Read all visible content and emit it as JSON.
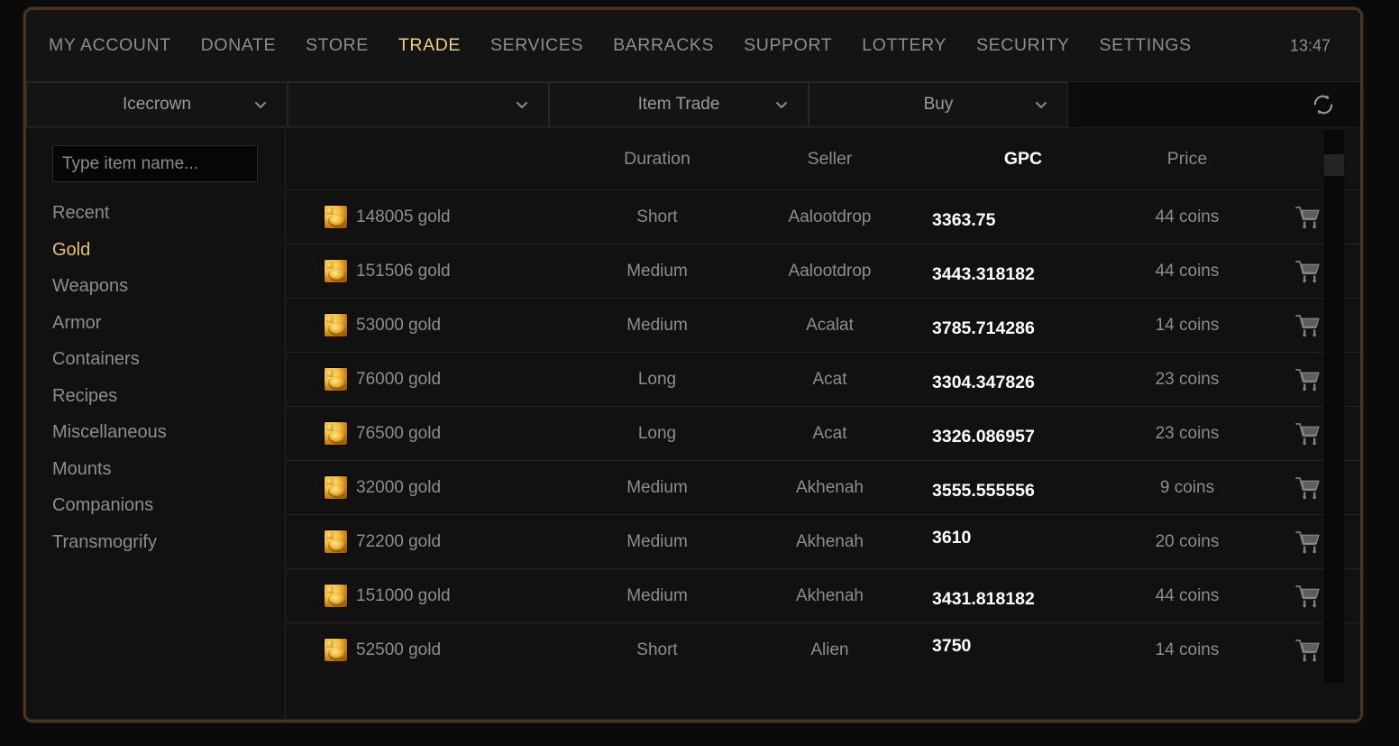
{
  "nav": {
    "items": [
      {
        "label": "MY ACCOUNT",
        "active": false
      },
      {
        "label": "DONATE",
        "active": false
      },
      {
        "label": "STORE",
        "active": false
      },
      {
        "label": "TRADE",
        "active": true
      },
      {
        "label": "SERVICES",
        "active": false
      },
      {
        "label": "BARRACKS",
        "active": false
      },
      {
        "label": "SUPPORT",
        "active": false
      },
      {
        "label": "LOTTERY",
        "active": false
      },
      {
        "label": "SECURITY",
        "active": false
      },
      {
        "label": "SETTINGS",
        "active": false
      }
    ],
    "clock": "13:47"
  },
  "filters": {
    "realm": "Icecrown",
    "character": "",
    "trade_type": "Item Trade",
    "action": "Buy",
    "refresh_icon": "refresh-icon"
  },
  "sidebar": {
    "search_placeholder": "Type item name...",
    "search_value": "",
    "categories": [
      {
        "label": "Recent",
        "active": false
      },
      {
        "label": "Gold",
        "active": true
      },
      {
        "label": "Weapons",
        "active": false
      },
      {
        "label": "Armor",
        "active": false
      },
      {
        "label": "Containers",
        "active": false
      },
      {
        "label": "Recipes",
        "active": false
      },
      {
        "label": "Miscellaneous",
        "active": false
      },
      {
        "label": "Mounts",
        "active": false
      },
      {
        "label": "Companions",
        "active": false
      },
      {
        "label": "Transmogrify",
        "active": false
      }
    ]
  },
  "table": {
    "headers": {
      "item": "",
      "duration": "Duration",
      "seller": "Seller",
      "gpc": "GPC",
      "price": "Price"
    },
    "sorted_column": "GPC",
    "rows": [
      {
        "icon": "gold-coins-icon",
        "item": "148005 gold",
        "duration": "Short",
        "seller": "Aalootdrop",
        "gpc": "3363.75",
        "price": "44 coins",
        "cart": "cart-icon"
      },
      {
        "icon": "gold-coins-icon",
        "item": "151506 gold",
        "duration": "Medium",
        "seller": "Aalootdrop",
        "gpc": "3443.318182",
        "price": "44 coins",
        "cart": "cart-icon"
      },
      {
        "icon": "gold-coins-icon",
        "item": "53000 gold",
        "duration": "Medium",
        "seller": "Acalat",
        "gpc": "3785.714286",
        "price": "14 coins",
        "cart": "cart-icon"
      },
      {
        "icon": "gold-coins-icon",
        "item": "76000 gold",
        "duration": "Long",
        "seller": "Acat",
        "gpc": "3304.347826",
        "price": "23 coins",
        "cart": "cart-icon"
      },
      {
        "icon": "gold-coins-icon",
        "item": "76500 gold",
        "duration": "Long",
        "seller": "Acat",
        "gpc": "3326.086957",
        "price": "23 coins",
        "cart": "cart-icon"
      },
      {
        "icon": "gold-coins-icon",
        "item": "32000 gold",
        "duration": "Medium",
        "seller": "Akhenah",
        "gpc": "3555.555556",
        "price": "9 coins",
        "cart": "cart-icon"
      },
      {
        "icon": "gold-coins-icon",
        "item": "72200 gold",
        "duration": "Medium",
        "seller": "Akhenah",
        "gpc": "3610",
        "price": "20 coins",
        "cart": "cart-icon"
      },
      {
        "icon": "gold-coins-icon",
        "item": "151000 gold",
        "duration": "Medium",
        "seller": "Akhenah",
        "gpc": "3431.818182",
        "price": "44 coins",
        "cart": "cart-icon"
      },
      {
        "icon": "gold-coins-icon",
        "item": "52500 gold",
        "duration": "Short",
        "seller": "Alien",
        "gpc": "3750",
        "price": "14 coins",
        "cart": "cart-icon"
      }
    ]
  },
  "colors": {
    "frame_border": "#4a3322",
    "accent_gold": "#e8c168",
    "text_muted": "#8d8d8d",
    "text_bright": "#ffffff",
    "panel_bg": "#111111"
  }
}
